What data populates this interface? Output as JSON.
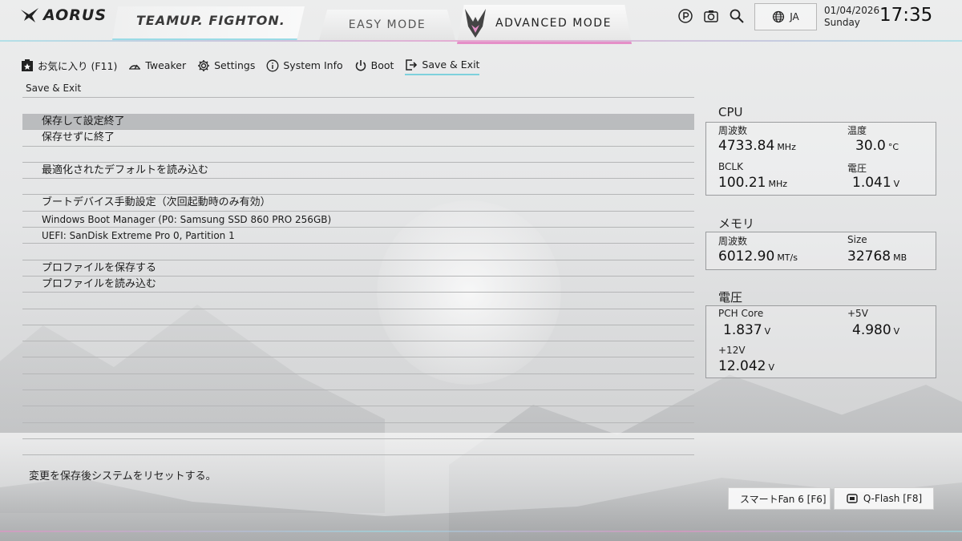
{
  "header": {
    "logo": "AORUS",
    "banner": "TEAMUP. FIGHTON.",
    "easy_mode": "EASY MODE",
    "advanced_mode": "ADVANCED MODE",
    "lang": "JA",
    "date": "01/04/2026",
    "day": "Sunday",
    "time": "17:35"
  },
  "nav": {
    "favorites": "お気に入り (F11)",
    "tweaker": "Tweaker",
    "settings": "Settings",
    "sysinfo": "System Info",
    "boot": "Boot",
    "save_exit": "Save & Exit"
  },
  "section_title": "Save & Exit",
  "menu": [
    "保存して設定終了",
    "保存せずに終了",
    "",
    "最適化されたデフォルトを読み込む",
    "",
    "ブートデバイス手動設定（次回起動時のみ有効）",
    "Windows Boot Manager (P0: Samsung SSD 860 PRO 256GB)",
    "UEFI: SanDisk Extreme Pro 0, Partition 1",
    "",
    "プロファイルを保存する",
    "プロファイルを読み込む",
    "",
    "",
    "",
    "",
    "",
    "",
    "",
    "",
    "",
    "",
    ""
  ],
  "help_text": "変更を保存後システムをリセットする。",
  "cpu": {
    "title": "CPU",
    "freq_label": "周波数",
    "freq_value": "4733.84",
    "freq_unit": "MHz",
    "temp_label": "温度",
    "temp_value": "30.0",
    "temp_unit": "°C",
    "bclk_label": "BCLK",
    "bclk_value": "100.21",
    "bclk_unit": "MHz",
    "volt_label": "電圧",
    "volt_value": "1.041",
    "volt_unit": "V"
  },
  "memory": {
    "title": "メモリ",
    "freq_label": "周波数",
    "freq_value": "6012.90",
    "freq_unit": "MT/s",
    "size_label": "Size",
    "size_value": "32768",
    "size_unit": "MB"
  },
  "voltage": {
    "title": "電圧",
    "pch_label": "PCH Core",
    "pch_value": "1.837",
    "pch_unit": "V",
    "v5_label": "+5V",
    "v5_value": "4.980",
    "v5_unit": "V",
    "v12_label": "+12V",
    "v12_value": "12.042",
    "v12_unit": "V"
  },
  "buttons": {
    "smartfan": "スマートFan 6 [F6]",
    "qflash": "Q-Flash [F8]"
  }
}
